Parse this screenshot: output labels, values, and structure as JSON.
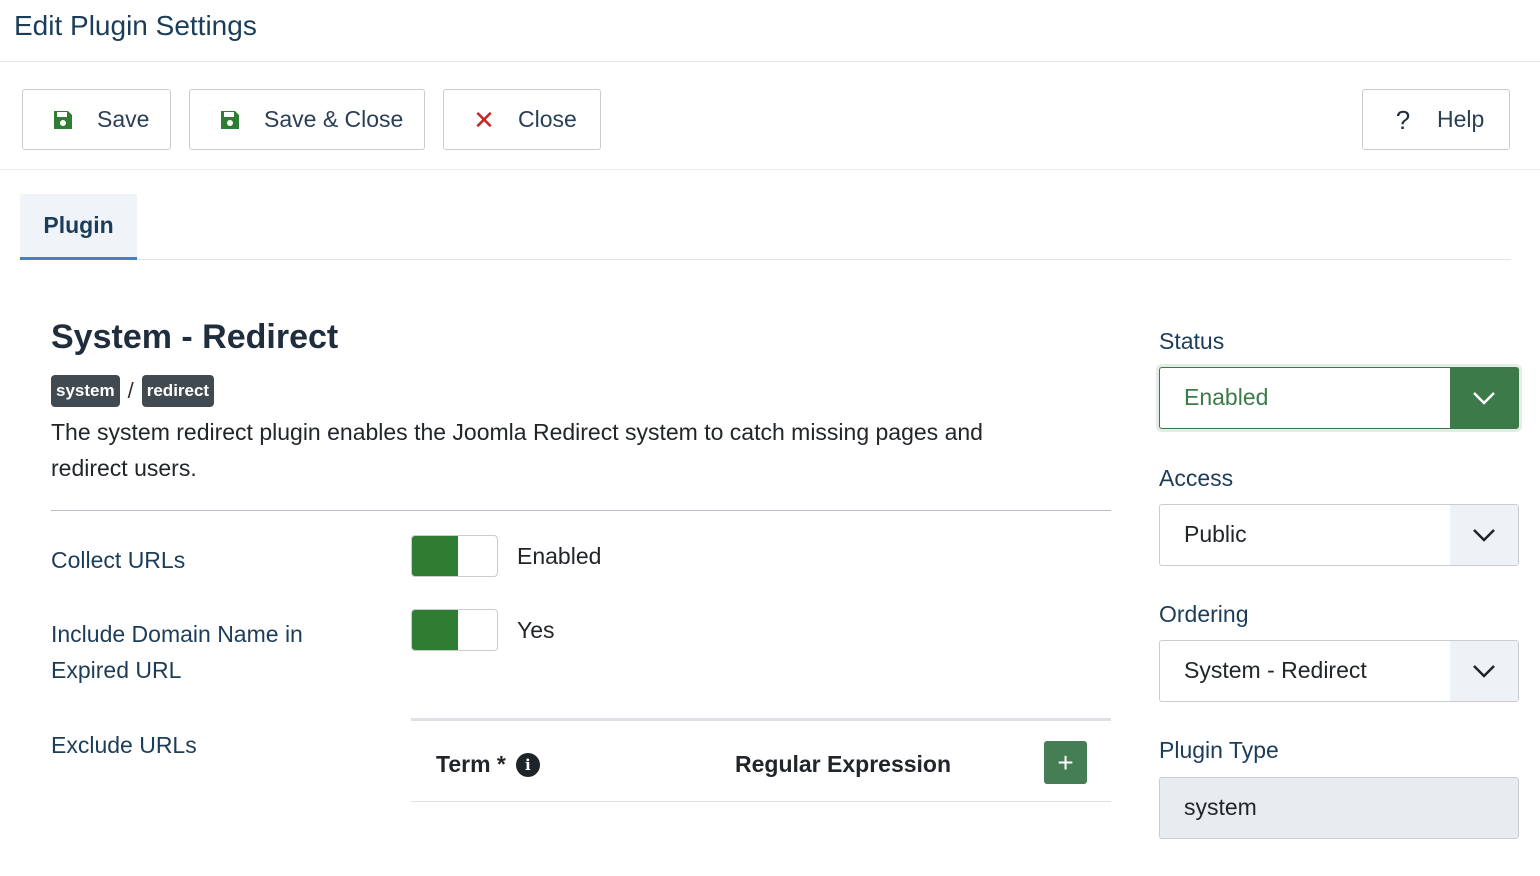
{
  "header": {
    "title": "Edit Plugin Settings"
  },
  "toolbar": {
    "save_label": "Save",
    "save_close_label": "Save & Close",
    "close_label": "Close",
    "close_glyph": "✕",
    "help_label": "Help",
    "help_glyph": "?"
  },
  "tabs": [
    {
      "label": "Plugin",
      "active": true
    }
  ],
  "plugin": {
    "name": "System - Redirect",
    "badges": [
      "system",
      "redirect"
    ],
    "badge_separator": "/",
    "description": "The system redirect plugin enables the Joomla Redirect system to catch missing pages and redirect users."
  },
  "fields": {
    "collect_urls": {
      "label": "Collect URLs",
      "value": "Enabled"
    },
    "include_domain": {
      "label": "Include Domain Name in Expired URL",
      "value": "Yes"
    },
    "exclude_urls": {
      "label": "Exclude URLs",
      "columns": {
        "term": "Term *",
        "regex": "Regular Expression"
      },
      "info_glyph": "i",
      "add_glyph": "+"
    }
  },
  "sidebar": {
    "status": {
      "label": "Status",
      "value": "Enabled"
    },
    "access": {
      "label": "Access",
      "value": "Public"
    },
    "ordering": {
      "label": "Ordering",
      "value": "System - Redirect"
    },
    "plugin_type": {
      "label": "Plugin Type",
      "value": "system"
    }
  },
  "colors": {
    "success": "#2e7d32",
    "accent_green": "#457d54",
    "danger": "#c52827",
    "tab_underline": "#4c7cc0",
    "title": "#1c3d5a"
  }
}
